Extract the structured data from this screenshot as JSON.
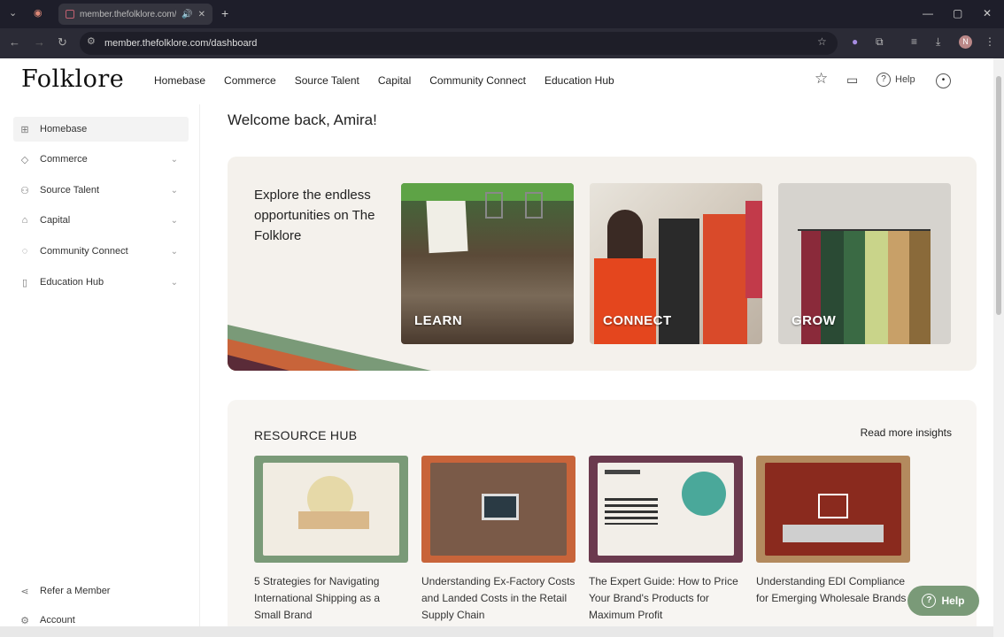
{
  "browser": {
    "tab_title": "member.thefolklore.com/d",
    "url": "member.thefolklore.com/dashboard",
    "profile_initial": "N"
  },
  "app": {
    "logo": "Folklore",
    "nav": [
      "Homebase",
      "Commerce",
      "Source Talent",
      "Capital",
      "Community Connect",
      "Education Hub"
    ],
    "help_label": "Help"
  },
  "sidebar": {
    "items": [
      {
        "label": "Homebase",
        "icon": "grid-icon"
      },
      {
        "label": "Commerce",
        "icon": "tag-icon"
      },
      {
        "label": "Source Talent",
        "icon": "people-icon"
      },
      {
        "label": "Capital",
        "icon": "bank-icon"
      },
      {
        "label": "Community Connect",
        "icon": "chat-icon"
      },
      {
        "label": "Education Hub",
        "icon": "book-icon"
      }
    ],
    "bottom": [
      {
        "label": "Refer a Member",
        "icon": "share-icon"
      },
      {
        "label": "Account",
        "icon": "settings-icon"
      }
    ]
  },
  "main": {
    "welcome": "Welcome back, Amira!",
    "banner_text": "Explore the endless opportunities on The Folklore",
    "cards": [
      "LEARN",
      "CONNECT",
      "GROW"
    ],
    "resource_title": "RESOURCE HUB",
    "read_more": "Read more insights",
    "resources": [
      "5 Strategies for Navigating International Shipping as a Small Brand",
      "Understanding Ex-Factory Costs and Landed Costs in the Retail Supply Chain",
      "The Expert Guide: How to Price Your Brand's Products for Maximum Profit",
      "Understanding EDI Compliance for Emerging Wholesale Brands"
    ]
  },
  "help_button": "Help",
  "colors": {
    "sage": "#7a9a78",
    "rust": "#c8643a",
    "plum": "#6b3a4e",
    "tan": "#b38a5e",
    "banner_bg": "#f4f1ec"
  }
}
